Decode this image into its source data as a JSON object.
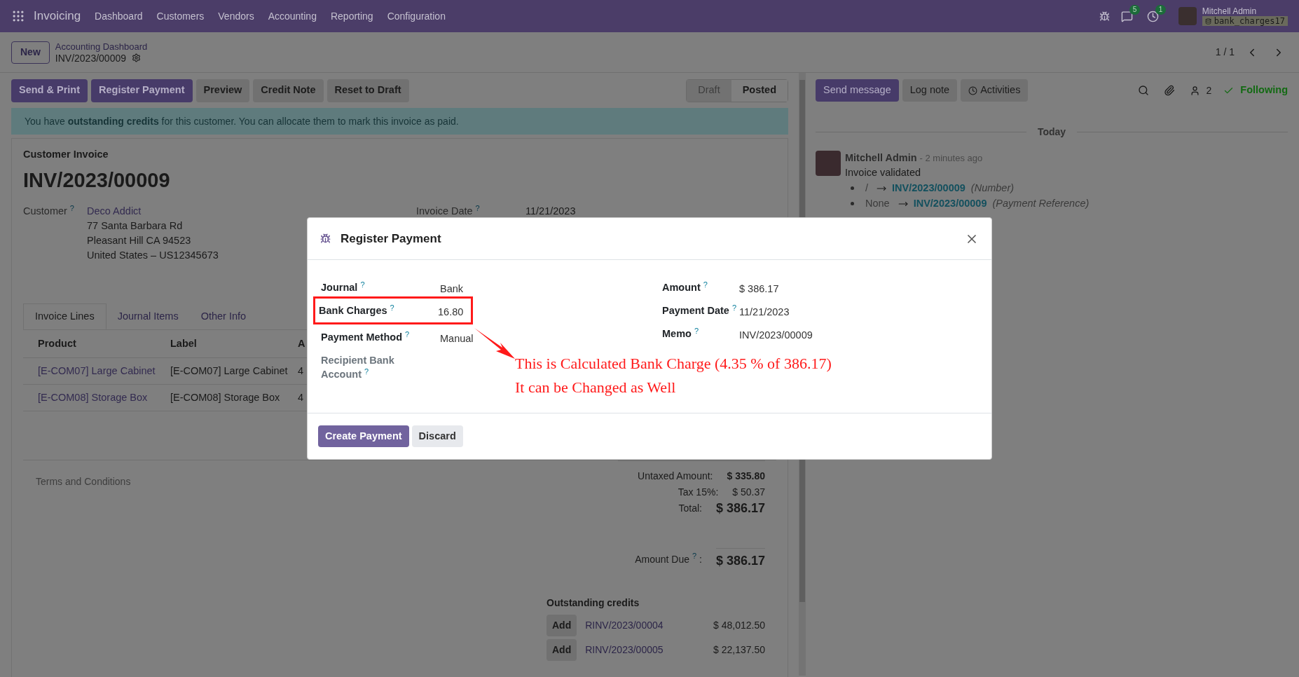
{
  "navbar": {
    "app": "Invoicing",
    "menu": [
      "Dashboard",
      "Customers",
      "Vendors",
      "Accounting",
      "Reporting",
      "Configuration"
    ],
    "messages_badge": "5",
    "activities_badge": "1",
    "user": "Mitchell Admin",
    "database": "bank_charges17"
  },
  "control_panel": {
    "new_button": "New",
    "breadcrumb": "Accounting Dashboard",
    "record": "INV/2023/00009",
    "pager": "1 / 1"
  },
  "actions": [
    {
      "label": "Send & Print",
      "kind": "primary"
    },
    {
      "label": "Register Payment",
      "kind": "primary"
    },
    {
      "label": "Preview",
      "kind": "secondary"
    },
    {
      "label": "Credit Note",
      "kind": "secondary"
    },
    {
      "label": "Reset to Draft",
      "kind": "secondary"
    }
  ],
  "status": [
    {
      "label": "Draft",
      "selected": false
    },
    {
      "label": "Posted",
      "selected": true
    }
  ],
  "alert": "You have **outstanding credits** for this customer. You can allocate them to mark this invoice as paid.",
  "invoice": {
    "type": "Customer Invoice",
    "number": "INV/2023/00009",
    "customer_label": "Customer",
    "help": "?",
    "customer": "Deco Addict",
    "address": [
      "77 Santa Barbara Rd",
      "Pleasant Hill CA 94523",
      "United States – US12345673"
    ],
    "date_label": "Invoice Date",
    "date": "11/21/2023"
  },
  "tabs": [
    {
      "label": "Invoice Lines",
      "selected": true
    },
    {
      "label": "Journal Items",
      "selected": false
    },
    {
      "label": "Other Info",
      "selected": false
    }
  ],
  "table": {
    "columns": [
      "Product",
      "Label",
      "A"
    ],
    "rows": [
      [
        "[E-COM07] Large Cabinet",
        "[E-COM07] Large Cabinet",
        "4"
      ],
      [
        "[E-COM08] Storage Box",
        "[E-COM08] Storage Box",
        "4"
      ]
    ]
  },
  "terms_placeholder": "Terms and Conditions",
  "totals": [
    {
      "label": "Untaxed Amount:",
      "value": "$ 335.80",
      "kind": "subtotal"
    },
    {
      "label": "Tax 15%:",
      "value": "$ 50.37",
      "kind": "tax"
    },
    {
      "label": "Total:",
      "value": "$ 386.17",
      "kind": "total"
    }
  ],
  "amount_due": {
    "label": "Amount Due",
    "help": "?",
    "colon": ":",
    "value": "$ 386.17"
  },
  "outstanding": {
    "title": "Outstanding credits",
    "items": [
      {
        "button": "Add",
        "ref": "RINV/2023/00004",
        "amount": "$ 48,012.50"
      },
      {
        "button": "Add",
        "ref": "RINV/2023/00005",
        "amount": "$ 22,137.50"
      }
    ]
  },
  "chatter": {
    "buttons": [
      {
        "label": "Send message",
        "kind": "primary"
      },
      {
        "label": "Log note",
        "kind": "secondary"
      },
      {
        "label": "Activities",
        "kind": "activities"
      }
    ],
    "followers": "2",
    "following": "Following",
    "date": "Today",
    "message": {
      "author": "Mitchell Admin",
      "time": "- 2 minutes ago",
      "body": "Invoice validated",
      "changes": [
        {
          "old": "/",
          "new": "INV/2023/00009",
          "field": "(Number)"
        },
        {
          "old": "None",
          "new": "INV/2023/00009",
          "field": "(Payment Reference)"
        }
      ]
    }
  },
  "dialog": {
    "title": "Register Payment",
    "left": [
      {
        "label": "Journal",
        "help": "?",
        "value": "Bank",
        "highlighted": false,
        "muted": false
      },
      {
        "label": "Bank Charges",
        "help": "?",
        "value": "16.80",
        "highlighted": true,
        "muted": false
      },
      {
        "label": "Payment Method",
        "help": "?",
        "value": "Manual",
        "highlighted": false,
        "muted": false
      },
      {
        "label": "Recipient Bank Account",
        "help": "?",
        "highlighted": false,
        "muted": true
      }
    ],
    "right": [
      {
        "label": "Amount",
        "help": "?",
        "value": "$ 386.17"
      },
      {
        "label": "Payment Date",
        "help": "?",
        "value": "11/21/2023"
      },
      {
        "label": "Memo",
        "help": "?",
        "value": "INV/2023/00009"
      }
    ],
    "annotation": [
      "This is Calculated Bank Charge (4.35 % of 386.17)",
      "It can be Changed as Well"
    ],
    "buttons": [
      {
        "label": "Create Payment",
        "kind": "primary"
      },
      {
        "label": "Discard",
        "kind": "secondary"
      }
    ]
  }
}
